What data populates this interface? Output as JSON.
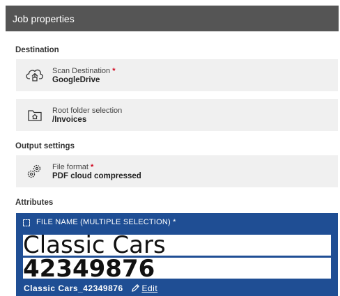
{
  "window": {
    "title": "Job properties"
  },
  "destination": {
    "section_label": "Destination",
    "scan_destination": {
      "label": "Scan Destination",
      "required_marker": "*",
      "value": "GoogleDrive",
      "icon": "cloud-upload-icon"
    },
    "root_folder": {
      "label": "Root folder selection",
      "value": "/Invoices",
      "icon": "folder-icon"
    }
  },
  "output_settings": {
    "section_label": "Output settings",
    "file_format": {
      "label": "File format",
      "required_marker": "*",
      "value": "PDF cloud compressed",
      "icon": "gears-icon"
    }
  },
  "attributes": {
    "section_label": "Attributes",
    "file_name": {
      "header": "FILE NAME (MULTIPLE SELECTION) *",
      "selections": [
        "Classic Cars",
        "42349876"
      ],
      "result": "Classic Cars_42349876",
      "edit_label": "Edit"
    }
  },
  "colors": {
    "title_bar": "#555555",
    "card_background": "#f0f0f0",
    "attribute_panel": "#1f4e94",
    "required_marker": "#d0021b"
  }
}
